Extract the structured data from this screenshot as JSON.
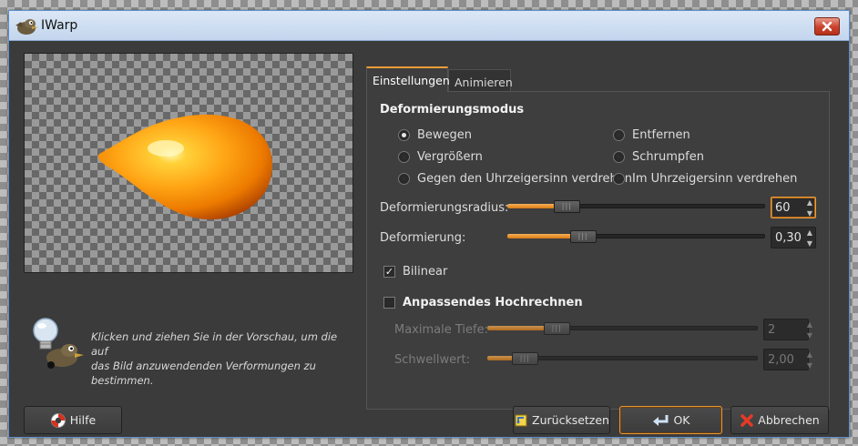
{
  "window": {
    "title": "IWarp"
  },
  "hint": {
    "text": "Klicken und ziehen Sie in der Vorschau, um die auf\ndas Bild anzuwendenden Verformungen zu\nbestimmen."
  },
  "tabs": [
    {
      "label": "Einstellungen",
      "active": true
    },
    {
      "label": "Animieren",
      "active": false
    }
  ],
  "mode": {
    "title": "Deformierungsmodus",
    "options": [
      {
        "label": "Bewegen",
        "selected": true
      },
      {
        "label": "Vergrößern",
        "selected": false
      },
      {
        "label": "Gegen den Uhrzeigersinn verdrehen",
        "selected": false
      },
      {
        "label": "Entfernen",
        "selected": false
      },
      {
        "label": "Schrumpfen",
        "selected": false
      },
      {
        "label": "Im Uhrzeigersinn verdrehen",
        "selected": false
      }
    ]
  },
  "radius": {
    "label": "Deformierungsradius:",
    "value": "60",
    "fraction": 0.2
  },
  "amount": {
    "label": "Deformierung:",
    "value": "0,30",
    "fraction": 0.27
  },
  "bilinear": {
    "label": "Bilinear",
    "checked": true
  },
  "supersample": {
    "label": "Anpassendes Hochrechnen",
    "checked": false,
    "depth": {
      "label": "Maximale Tiefe:",
      "value": "2",
      "fraction": 0.23
    },
    "threshold": {
      "label": "Schwellwert:",
      "value": "2,00",
      "fraction": 0.1
    }
  },
  "buttons": {
    "help": "Hilfe",
    "reset": "Zurücksetzen",
    "ok": "OK",
    "cancel": "Abbrechen"
  },
  "colors": {
    "accent": "#f09c38",
    "blob_light": "#ffd23a",
    "blob_dark": "#a83c00"
  },
  "icons": {
    "app": "wilber-icon",
    "close": "close-icon",
    "hint": "lightbulb-wilber-icon",
    "help": "lifebuoy-icon",
    "reset": "reset-icon",
    "ok": "enter-arrow-icon",
    "cancel": "cancel-x-icon"
  }
}
